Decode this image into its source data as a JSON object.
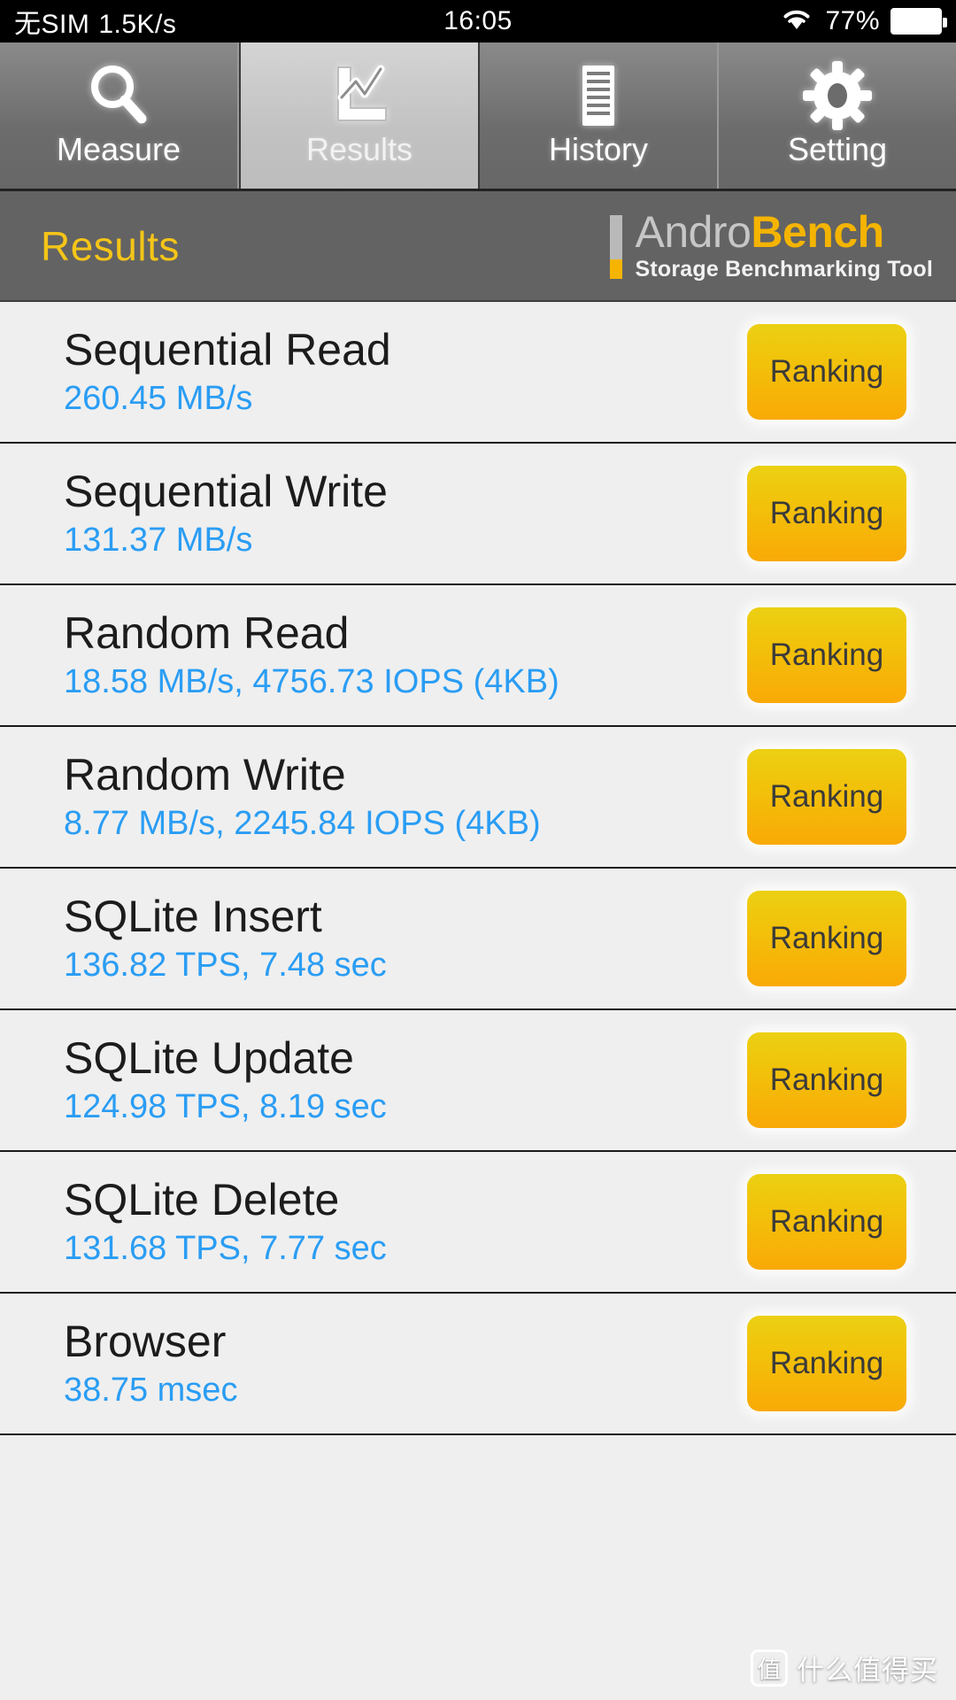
{
  "status_bar": {
    "carrier": "无SIM",
    "network_speed": "1.5K/s",
    "time": "16:05",
    "wifi_icon": "wifi-icon",
    "battery_percent": "77%",
    "battery_icon": "battery-icon"
  },
  "tabs": [
    {
      "label": "Measure",
      "icon": "magnifier-icon",
      "active": false
    },
    {
      "label": "Results",
      "icon": "chart-icon",
      "active": true
    },
    {
      "label": "History",
      "icon": "document-lines-icon",
      "active": false
    },
    {
      "label": "Setting",
      "icon": "gear-icon",
      "active": false
    }
  ],
  "header": {
    "title": "Results",
    "logo_primary": "Andro",
    "logo_secondary": "Bench",
    "logo_subtitle": "Storage Benchmarking Tool"
  },
  "colors": {
    "title_yellow": "#f5c518",
    "logo_gray": "#c6c6c6",
    "logo_yellow": "#f5b400",
    "value_blue": "#2a9df4",
    "button_top": "#ebd013",
    "button_bottom": "#f9a906",
    "header_bg": "#636363",
    "list_bg": "#efefef"
  },
  "results": [
    {
      "name": "Sequential Read",
      "value": "260.45 MB/s",
      "button": "Ranking"
    },
    {
      "name": "Sequential Write",
      "value": "131.37 MB/s",
      "button": "Ranking"
    },
    {
      "name": "Random Read",
      "value": "18.58 MB/s, 4756.73 IOPS (4KB)",
      "button": "Ranking"
    },
    {
      "name": "Random Write",
      "value": "8.77 MB/s, 2245.84 IOPS (4KB)",
      "button": "Ranking"
    },
    {
      "name": "SQLite Insert",
      "value": "136.82 TPS, 7.48 sec",
      "button": "Ranking"
    },
    {
      "name": "SQLite Update",
      "value": "124.98 TPS, 8.19 sec",
      "button": "Ranking"
    },
    {
      "name": "SQLite Delete",
      "value": "131.68 TPS, 7.77 sec",
      "button": "Ranking"
    },
    {
      "name": "Browser",
      "value": "38.75 msec",
      "button": "Ranking"
    }
  ],
  "watermark": {
    "badge": "值",
    "text": "什么值得买"
  }
}
